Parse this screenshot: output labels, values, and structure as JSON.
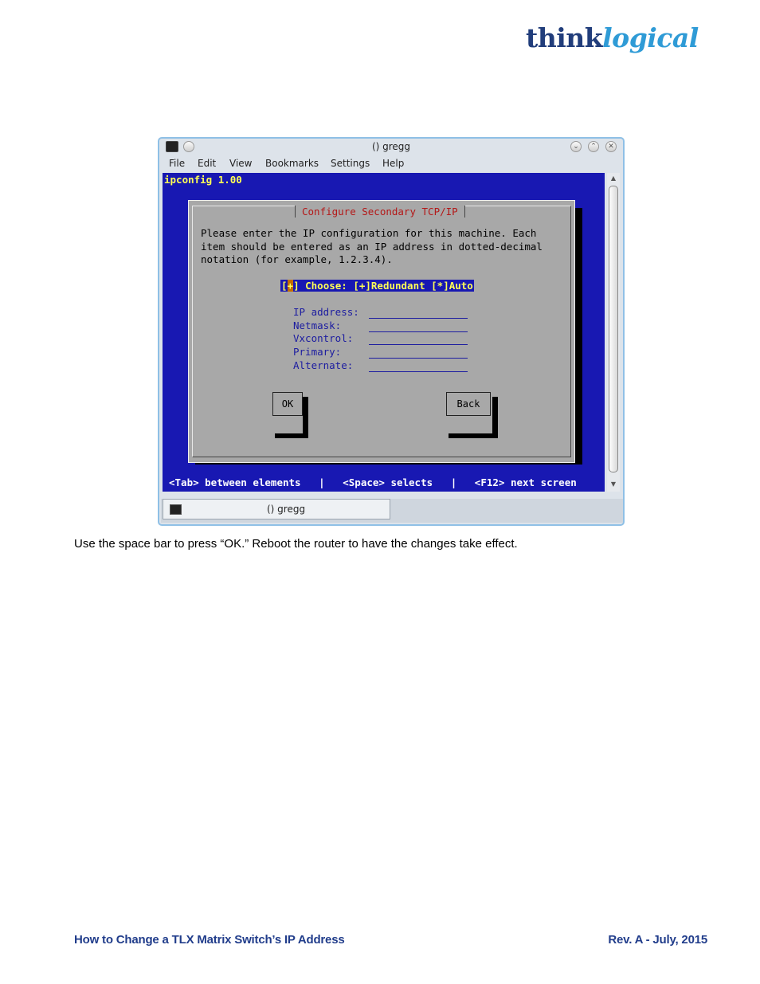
{
  "logo": {
    "part1": "think",
    "part2": "logical"
  },
  "window": {
    "title": "() gregg",
    "menu": [
      "File",
      "Edit",
      "View",
      "Bookmarks",
      "Settings",
      "Help"
    ],
    "minimize_glyph": "⌄",
    "maximize_glyph": "⌃",
    "close_glyph": "✕"
  },
  "terminal": {
    "app_title": "ipconfig 1.00",
    "dialog_title": "Configure Secondary TCP/IP",
    "intro_lines": [
      "Please enter the IP configuration for this machine. Each",
      "item should be entered as an IP address in dotted-decimal",
      "notation (for example, 1.2.3.4)."
    ],
    "choose": {
      "open": "[",
      "cursor": "+",
      "rest": "] Choose: [+]Redundant [*]Auto"
    },
    "fields": [
      {
        "label": "IP address:",
        "value": ""
      },
      {
        "label": "Netmask:",
        "value": ""
      },
      {
        "label": "Vxcontrol:",
        "value": ""
      },
      {
        "label": "Primary:",
        "value": ""
      },
      {
        "label": "Alternate:",
        "value": ""
      }
    ],
    "ok_label": "OK",
    "back_label": "Back",
    "status_line": "<Tab> between elements   |   <Space> selects   |   <F12> next screen"
  },
  "tab": {
    "label": "() gregg"
  },
  "caption": "Use the space bar to press “OK.” Reboot the router to have the changes take effect.",
  "footer": {
    "left": "How to Change a TLX Matrix Switch’s IP Address",
    "right": "Rev. A - July, 2015"
  },
  "colors": {
    "brand_dark": "#213d7b",
    "brand_light": "#2f9bd6",
    "terminal_blue": "#1818b2",
    "dialog_gray": "#a8a8a8",
    "title_red": "#b41818"
  }
}
